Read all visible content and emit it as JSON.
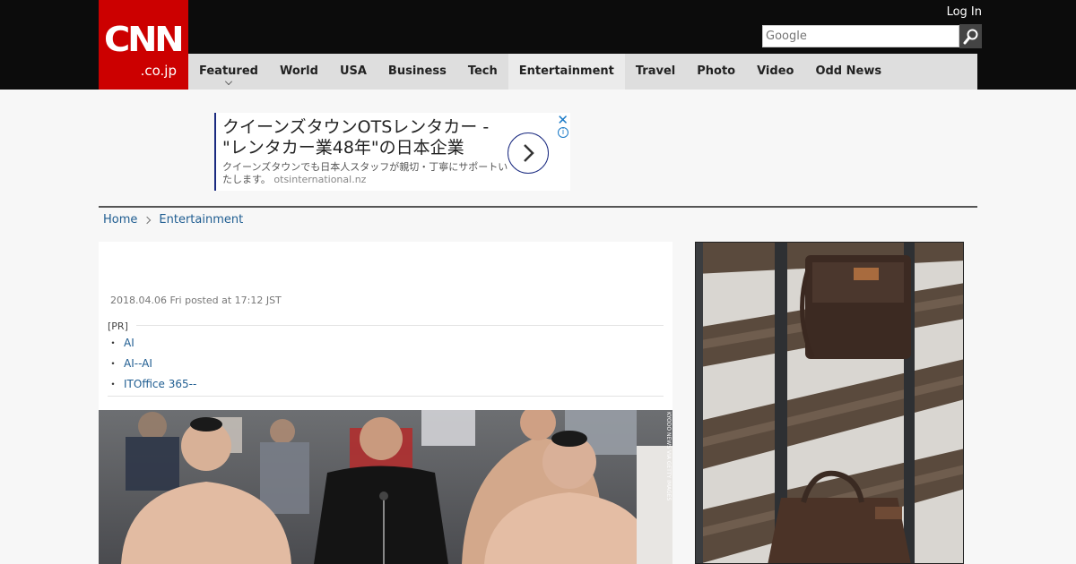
{
  "header": {
    "logo_main": "CNN",
    "logo_sub": ".co.jp",
    "login_label": "Log In",
    "search_placeholder": "Google",
    "search_icon": "search-icon",
    "colors": {
      "brand": "#cc0000",
      "topbar": "#0c0c0c",
      "nav_bg": "#dedede"
    }
  },
  "nav": {
    "items": [
      {
        "label": "Featured"
      },
      {
        "label": "World"
      },
      {
        "label": "USA"
      },
      {
        "label": "Business"
      },
      {
        "label": "Tech"
      },
      {
        "label": "Entertainment"
      },
      {
        "label": "Travel"
      },
      {
        "label": "Photo"
      },
      {
        "label": "Video"
      },
      {
        "label": "Odd News"
      }
    ],
    "active": "Entertainment"
  },
  "top_ad": {
    "title": "クイーンズタウンOTSレンタカー - \"レンタカー業48年\"の日本企業",
    "description": "クイーンズタウンでも日本人スタッフが親切・丁寧にサポートいたします。",
    "url": "otsinternational.nz",
    "close_icon": "close-icon",
    "info_icon": "info-icon",
    "go_icon": "chevron-right-icon"
  },
  "breadcrumb": {
    "home": "Home",
    "current": "Entertainment"
  },
  "article": {
    "posted": "2018.04.06 Fri posted at 17:12 JST",
    "pr_label": "[PR]",
    "pr_links": [
      {
        "label": "AI"
      },
      {
        "label": "AI--AI"
      },
      {
        "label": "ITOffice 365--"
      }
    ],
    "photo_credit": "KYODO NEWS VIA GETTY IMAGES"
  }
}
